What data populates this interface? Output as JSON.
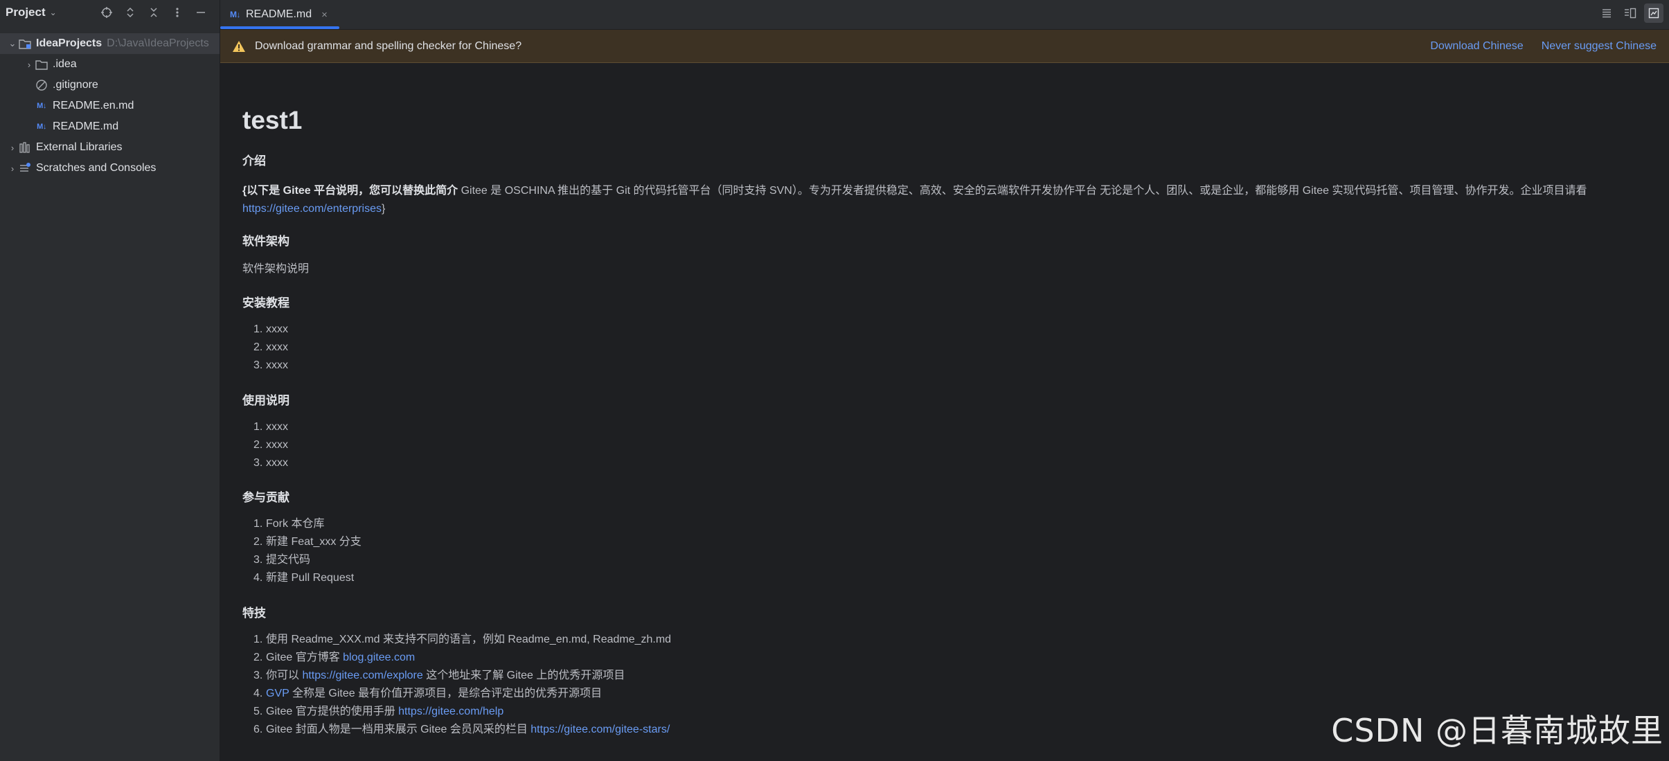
{
  "sidebar": {
    "title": "Project",
    "tree": {
      "root_label": "IdeaProjects",
      "root_path": "D:\\Java\\IdeaProjects",
      "items": [
        {
          "label": ".idea",
          "type": "folder"
        },
        {
          "label": ".gitignore",
          "type": "ignore-file"
        },
        {
          "label": "README.en.md",
          "type": "markdown"
        },
        {
          "label": "README.md",
          "type": "markdown"
        }
      ],
      "external_libraries": "External Libraries",
      "scratches": "Scratches and Consoles"
    }
  },
  "editor": {
    "tab_label": "README.md",
    "md_badge": "M↓"
  },
  "notification": {
    "message": "Download grammar and spelling checker for Chinese?",
    "download_label": "Download Chinese",
    "never_label": "Never suggest Chinese"
  },
  "preview": {
    "title": "test1",
    "intro_heading": "介绍",
    "intro_bold": "{以下是 Gitee 平台说明，您可以替换此简介",
    "intro_text": " Gitee 是 OSCHINA 推出的基于 Git 的代码托管平台（同时支持 SVN）。专为开发者提供稳定、高效、安全的云端软件开发协作平台 无论是个人、团队、或是企业，都能够用 Gitee 实现代码托管、项目管理、协作开发。企业项目请看 ",
    "intro_link": "https://gitee.com/enterprises",
    "intro_end": "}",
    "arch_heading": "软件架构",
    "arch_text": "软件架构说明",
    "install_heading": "安装教程",
    "install_items": [
      "xxxx",
      "xxxx",
      "xxxx"
    ],
    "usage_heading": "使用说明",
    "usage_items": [
      "xxxx",
      "xxxx",
      "xxxx"
    ],
    "contrib_heading": "参与贡献",
    "contrib_items": [
      "Fork 本仓库",
      "新建 Feat_xxx 分支",
      "提交代码",
      "新建 Pull Request"
    ],
    "special_heading": "特技",
    "special_items": [
      {
        "pre": "使用 Readme_XXX.md 来支持不同的语言，例如 Readme_en.md, Readme_zh.md",
        "link": "",
        "post": ""
      },
      {
        "pre": "Gitee 官方博客 ",
        "link": "blog.gitee.com",
        "post": ""
      },
      {
        "pre": "你可以 ",
        "link": "https://gitee.com/explore",
        "post": " 这个地址来了解 Gitee 上的优秀开源项目"
      },
      {
        "pre": "",
        "link": "GVP",
        "post": " 全称是 Gitee 最有价值开源项目，是综合评定出的优秀开源项目"
      },
      {
        "pre": "Gitee 官方提供的使用手册 ",
        "link": "https://gitee.com/help",
        "post": ""
      },
      {
        "pre": "Gitee 封面人物是一档用来展示 Gitee 会员风采的栏目 ",
        "link": "https://gitee.com/gitee-stars/",
        "post": ""
      }
    ]
  },
  "watermark": "CSDN @日暮南城故里",
  "colors": {
    "accent": "#3574f0",
    "link": "#6a9cf4",
    "warning": "#f2c55c",
    "panel_bg": "#2b2d30",
    "editor_bg": "#1e1f22",
    "notification_bg": "#3d3223"
  }
}
